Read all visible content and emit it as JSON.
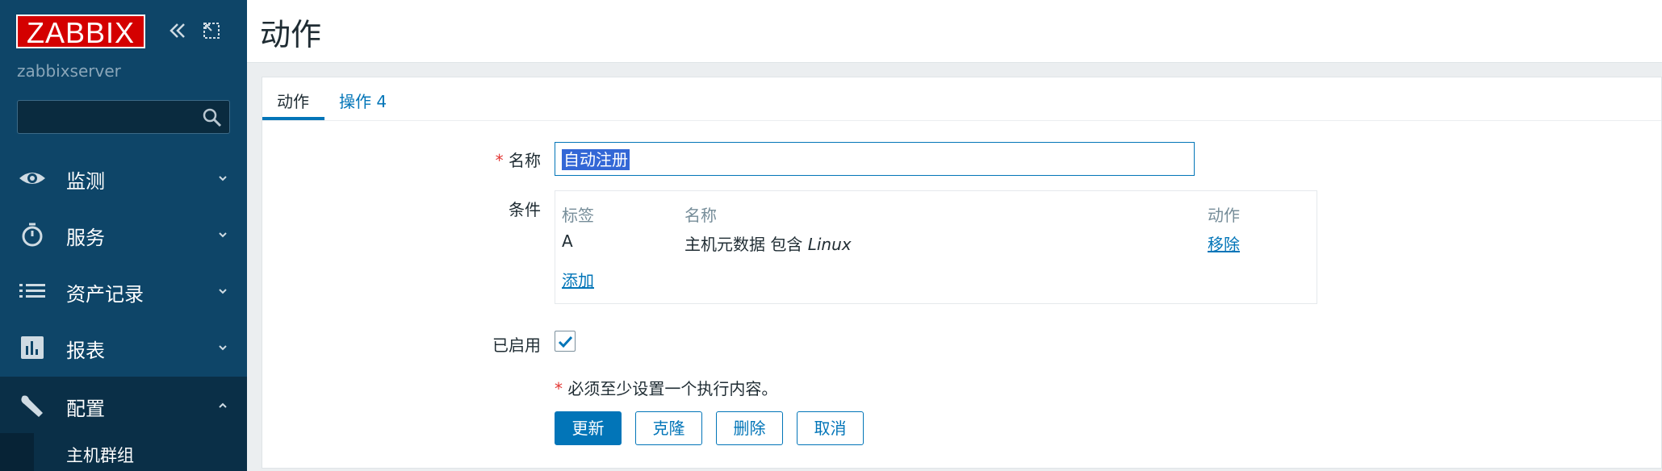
{
  "sidebar": {
    "logo": "ZABBIX",
    "server_name": "zabbixserver",
    "search": {
      "value": "",
      "placeholder": ""
    },
    "menu": [
      {
        "label": "监测",
        "icon": "eye-icon"
      },
      {
        "label": "服务",
        "icon": "stopwatch-icon"
      },
      {
        "label": "资产记录",
        "icon": "list-icon"
      },
      {
        "label": "报表",
        "icon": "bar-chart-icon"
      },
      {
        "label": "配置",
        "icon": "wrench-icon",
        "expanded": true
      }
    ],
    "submenu": [
      {
        "label": "主机群组"
      }
    ]
  },
  "header": {
    "title": "动作"
  },
  "tabs": [
    {
      "label": "动作",
      "active": true
    },
    {
      "label": "操作 4",
      "active": false
    }
  ],
  "form": {
    "name_label": "名称",
    "name_required_mark": "*",
    "name_value": "自动注册",
    "conditions_label": "条件",
    "conditions": {
      "headers": [
        "标签",
        "名称",
        "动作"
      ],
      "rows": [
        {
          "tag": "A",
          "name_prefix": "主机元数据 包含 ",
          "name_value": "Linux",
          "action": "移除"
        }
      ],
      "add_label": "添加"
    },
    "enabled_label": "已启用",
    "enabled": true,
    "note_mark": "*",
    "note": " 必须至少设置一个执行内容。"
  },
  "buttons": {
    "update": "更新",
    "clone": "克隆",
    "delete": "删除",
    "cancel": "取消"
  },
  "colors": {
    "sidebar_bg": "#0e4568",
    "accent": "#0275b8",
    "logo_red": "#d40000"
  }
}
